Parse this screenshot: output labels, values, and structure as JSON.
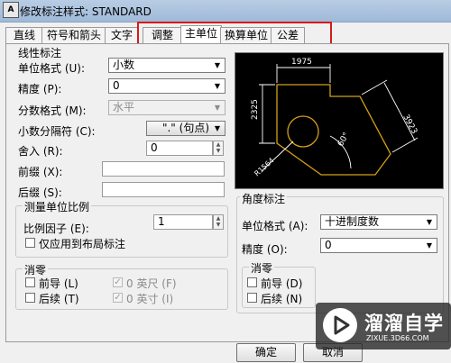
{
  "window": {
    "title": "修改标注样式: STANDARD",
    "icon": "app-icon"
  },
  "tabs": [
    {
      "label": "直线",
      "active": false
    },
    {
      "label": "符号和箭头",
      "active": false
    },
    {
      "label": "文字",
      "active": false
    },
    {
      "label": "调整",
      "active": false
    },
    {
      "label": "主单位",
      "active": true
    },
    {
      "label": "换算单位",
      "active": false
    },
    {
      "label": "公差",
      "active": false
    }
  ],
  "linear": {
    "title": "线性标注",
    "unit_format_label": "单位格式 (U):",
    "unit_format_value": "小数",
    "precision_label": "精度 (P):",
    "precision_value": "0",
    "fraction_label": "分数格式 (M):",
    "fraction_value": "水平",
    "decimal_sep_label": "小数分隔符 (C):",
    "decimal_sep_value": "\".\" (句点)",
    "round_label": "舍入 (R):",
    "round_value": "0",
    "prefix_label": "前缀 (X):",
    "prefix_value": "",
    "suffix_label": "后缀 (S):",
    "suffix_value": ""
  },
  "scale": {
    "title": "测量单位比例",
    "factor_label": "比例因子 (E):",
    "factor_value": "1",
    "layout_only_label": "仅应用到布局标注"
  },
  "zero_left": {
    "title": "消零",
    "leading_label": "前导 (L)",
    "trailing_label": "后续 (T)",
    "feet_label": "0 英尺 (F)",
    "inches_label": "0 英寸 (I)"
  },
  "angular": {
    "title": "角度标注",
    "unit_format_label": "单位格式 (A):",
    "unit_format_value": "十进制度数",
    "precision_label": "精度 (O):",
    "precision_value": "0"
  },
  "zero_right": {
    "title": "消零",
    "leading_label": "前导 (D)",
    "trailing_label": "后续 (N)"
  },
  "preview": {
    "dim_top": "1975",
    "dim_left": "2325",
    "dim_right": "3923",
    "dim_angle": "60°",
    "dim_radius": "R1564",
    "line_color": "#d4a017",
    "dim_color": "#ffffff"
  },
  "buttons": {
    "ok": "确定",
    "cancel": "取消"
  },
  "watermark": {
    "text": "溜溜自学",
    "url": "ZIXUE.3D66.COM"
  }
}
